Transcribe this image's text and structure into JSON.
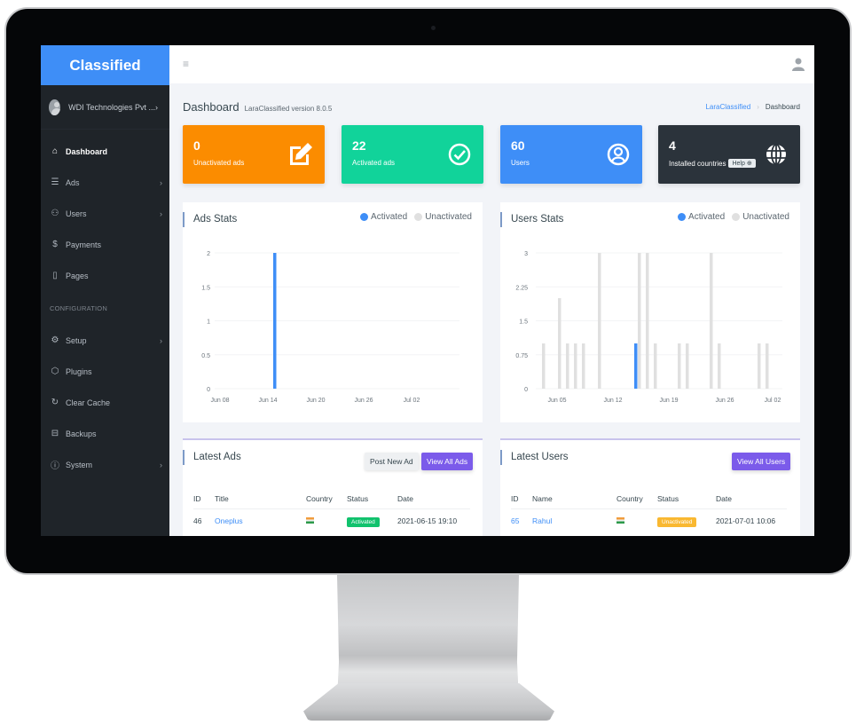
{
  "sidebar": {
    "brand": "Classified",
    "user_name": "WDI Technologies Pvt ...",
    "items": [
      {
        "label": "Dashboard",
        "icon": "home-icon",
        "active": true,
        "chevron": false
      },
      {
        "label": "Ads",
        "icon": "list-icon",
        "active": false,
        "chevron": true
      },
      {
        "label": "Users",
        "icon": "users-icon",
        "active": false,
        "chevron": true
      },
      {
        "label": "Payments",
        "icon": "dollar-icon",
        "active": false,
        "chevron": false
      },
      {
        "label": "Pages",
        "icon": "book-icon",
        "active": false,
        "chevron": false
      }
    ],
    "section_label": "CONFIGURATION",
    "config_items": [
      {
        "label": "Setup",
        "icon": "gear-icon",
        "chevron": true
      },
      {
        "label": "Plugins",
        "icon": "cube-icon",
        "chevron": false
      },
      {
        "label": "Clear Cache",
        "icon": "refresh-icon",
        "chevron": false
      },
      {
        "label": "Backups",
        "icon": "drive-icon",
        "chevron": false
      },
      {
        "label": "System",
        "icon": "info-icon",
        "chevron": true
      }
    ]
  },
  "header": {
    "title": "Dashboard",
    "subtitle": "LaraClassified version 8.0.5",
    "breadcrumb": {
      "root": "LaraClassified",
      "current": "Dashboard"
    }
  },
  "stats": [
    {
      "value": "0",
      "label": "Unactivated ads",
      "icon": "edit-icon",
      "color": "#fb8c00"
    },
    {
      "value": "22",
      "label": "Activated ads",
      "icon": "check-circle-icon",
      "color": "#11d39a"
    },
    {
      "value": "60",
      "label": "Users",
      "icon": "user-circle-icon",
      "color": "#3e8ef7"
    },
    {
      "value": "4",
      "label": "Installed countries",
      "icon": "globe-icon",
      "color": "#2b333b",
      "help": "Help"
    }
  ],
  "colors": {
    "activated": "#3e8ef7",
    "unactivated": "#e0e0e0",
    "brand": "#3e8ef7",
    "primary_button": "#7b5bea"
  },
  "chart_data": [
    {
      "type": "bar",
      "title": "Ads Stats",
      "legend": [
        "Activated",
        "Unactivated"
      ],
      "legend_position": "top-right",
      "x": [
        "Jun 15"
      ],
      "x_ticks": [
        "Jun 08",
        "Jun 14",
        "Jun 20",
        "Jun 26",
        "Jul 02"
      ],
      "y_ticks": [
        "0",
        "0.5",
        "1",
        "1.5",
        "2"
      ],
      "ylim": [
        0,
        2
      ],
      "series": [
        {
          "name": "Activated",
          "points": [
            {
              "date": "Jun 15",
              "value": 2
            }
          ]
        },
        {
          "name": "Unactivated",
          "points": []
        }
      ]
    },
    {
      "type": "bar",
      "title": "Users Stats",
      "legend": [
        "Activated",
        "Unactivated"
      ],
      "legend_position": "top-right",
      "x_ticks": [
        "Jun 05",
        "Jun 12",
        "Jun 19",
        "Jun 26",
        "Jul 02"
      ],
      "y_ticks": [
        "0",
        "0.75",
        "1.5",
        "2.25",
        "3"
      ],
      "ylim": [
        0,
        3
      ],
      "series": [
        {
          "name": "Activated",
          "points": [
            {
              "date": "Jun 15",
              "value": 1
            }
          ]
        },
        {
          "name": "Unactivated",
          "points": [
            {
              "date": "Jun 03",
              "value": 1
            },
            {
              "date": "Jun 05",
              "value": 2
            },
            {
              "date": "Jun 06",
              "value": 1
            },
            {
              "date": "Jun 07",
              "value": 1
            },
            {
              "date": "Jun 08",
              "value": 1
            },
            {
              "date": "Jun 10",
              "value": 3
            },
            {
              "date": "Jun 15",
              "value": 3
            },
            {
              "date": "Jun 16",
              "value": 3
            },
            {
              "date": "Jun 17",
              "value": 1
            },
            {
              "date": "Jun 20",
              "value": 1
            },
            {
              "date": "Jun 21",
              "value": 1
            },
            {
              "date": "Jun 24",
              "value": 3
            },
            {
              "date": "Jun 25",
              "value": 1
            },
            {
              "date": "Jun 30",
              "value": 1
            },
            {
              "date": "Jul 01",
              "value": 1
            }
          ]
        }
      ]
    }
  ],
  "latest_ads": {
    "title": "Latest Ads",
    "post_button": "Post New Ad",
    "view_button": "View All Ads",
    "columns": [
      "ID",
      "Title",
      "Country",
      "Status",
      "Date"
    ],
    "rows": [
      {
        "id": "46",
        "title": "Oneplus",
        "country": "India",
        "status": "Activated",
        "status_color": "#11c26d",
        "date": "2021-06-15 19:10"
      }
    ]
  },
  "latest_users": {
    "title": "Latest Users",
    "view_button": "View All Users",
    "columns": [
      "ID",
      "Name",
      "Country",
      "Status",
      "Date"
    ],
    "rows": [
      {
        "id": "65",
        "name": "Rahul",
        "country": "India",
        "status": "Unactivated",
        "status_color": "#f9b831",
        "date": "2021-07-01 10:06"
      }
    ]
  }
}
